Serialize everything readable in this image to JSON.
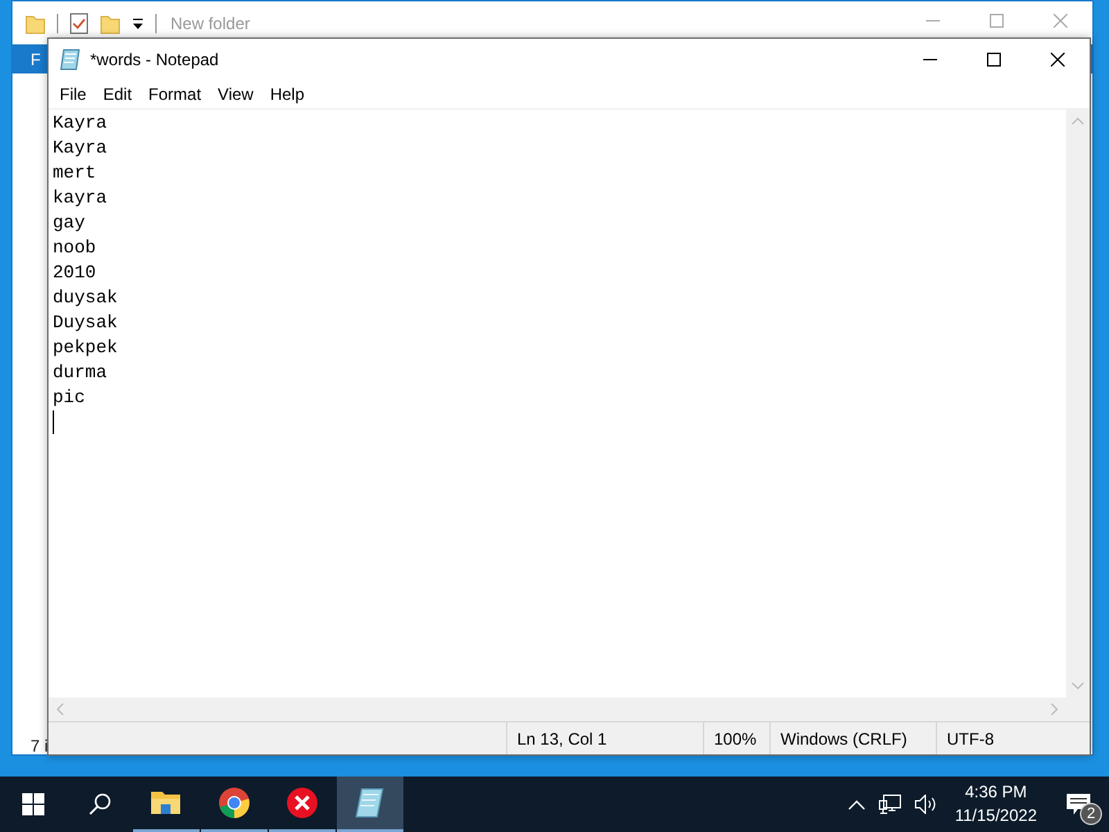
{
  "explorer": {
    "title": "New folder",
    "ribbon_tab": "F",
    "status": "7 i"
  },
  "notepad": {
    "title": "*words - Notepad",
    "menu": [
      "File",
      "Edit",
      "Format",
      "View",
      "Help"
    ],
    "lines": [
      "Kayra",
      "Kayra",
      "mert",
      "kayra",
      "gay",
      "noob",
      "2010",
      "duysak",
      "Duysak",
      "pekpek",
      "durma",
      "pic"
    ],
    "status": {
      "position": "Ln 13, Col 1",
      "zoom": "100%",
      "line_ending": "Windows (CRLF)",
      "encoding": "UTF-8"
    }
  },
  "taskbar": {
    "apps": [
      {
        "kind": "explorer",
        "selected": false
      },
      {
        "kind": "chrome",
        "selected": false
      },
      {
        "kind": "error",
        "selected": false
      },
      {
        "kind": "notepad",
        "selected": true
      }
    ],
    "time": "4:36 PM",
    "date": "11/15/2022",
    "notification_count": "2"
  }
}
